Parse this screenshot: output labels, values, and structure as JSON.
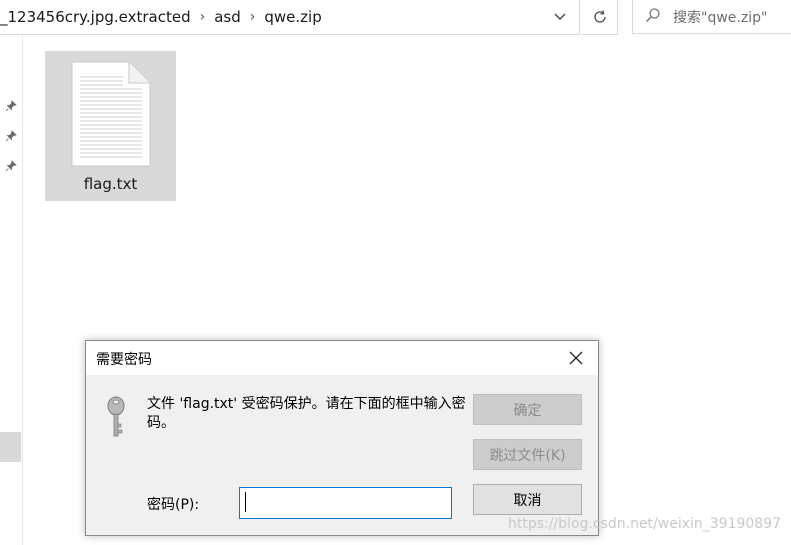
{
  "address_bar": {
    "crumbs": [
      "_123456cry.jpg.extracted",
      "asd",
      "qwe.zip"
    ],
    "separator": "›",
    "dropdown_icon": "chevron-down-icon",
    "refresh_icon": "refresh-icon"
  },
  "search": {
    "placeholder": "搜索\"qwe.zip\"",
    "icon": "search-icon"
  },
  "files": [
    {
      "name": "flag.txt",
      "icon": "text-file-icon",
      "selected": true
    }
  ],
  "dialog": {
    "title": "需要密码",
    "message": "文件 'flag.txt' 受密码保护。请在下面的框中输入密码。",
    "password_label": "密码(P):",
    "password_value": "",
    "buttons": {
      "ok": "确定",
      "skip": "跳过文件(K)",
      "cancel": "取消"
    }
  },
  "watermark": "https://blog.csdn.net/weixin_39190897"
}
